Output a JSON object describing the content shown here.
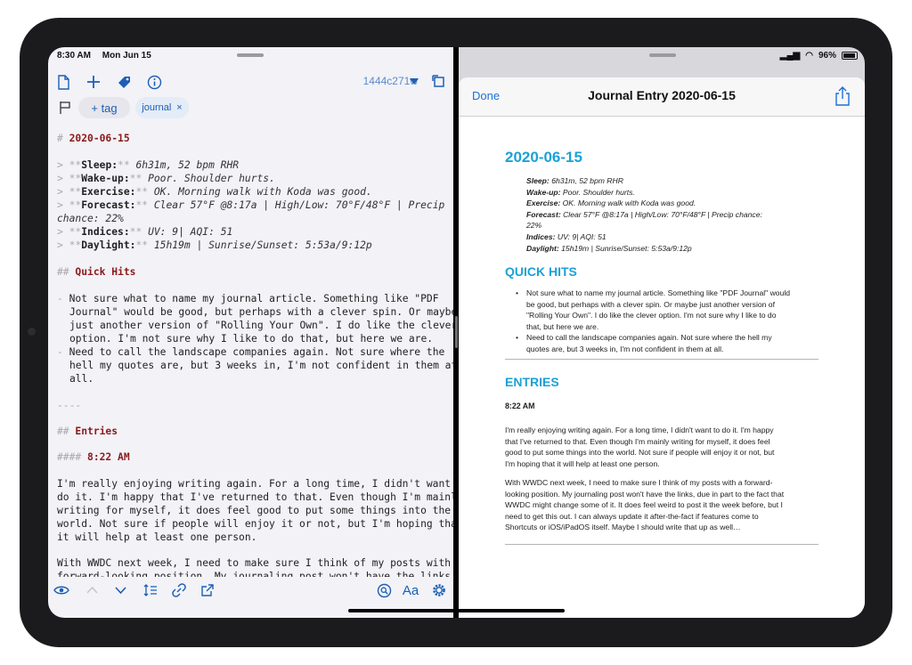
{
  "status": {
    "time": "8:30 AM",
    "date": "Mon Jun 15",
    "battery": "96%",
    "battery_level": 0.96
  },
  "left_toolbar": {
    "doc_id": "1444c271w"
  },
  "tags": {
    "add_label": "+ tag",
    "chip_label": "journal",
    "chip_remove": "×"
  },
  "editor": {
    "h1_marker": "#",
    "h1": "2020-06-15",
    "quote_marker": ">",
    "bold_marker": "**",
    "meta": [
      {
        "label": "Sleep:",
        "value": "6h31m, 52 bpm RHR"
      },
      {
        "label": "Wake-up:",
        "value": "Poor. Shoulder hurts."
      },
      {
        "label": "Exercise:",
        "value": "OK. Morning walk with Koda was good."
      },
      {
        "label": "Forecast:",
        "value": "Clear 57°F @8:17a | High/Low: 70°F/48°F | Precip"
      },
      {
        "label": "Indices:",
        "value": "UV: 9| AQI: 51"
      },
      {
        "label": "Daylight:",
        "value": "15h19m | Sunrise/Sunset: 5:53a/9:12p"
      }
    ],
    "forecast_wrap": "chance: 22%",
    "h2_marker": "##",
    "h2_quick": "Quick Hits",
    "list_marker": "-",
    "quick_lines": [
      "Not sure what to name my journal article. Something like \"PDF",
      "Journal\" would be good, but perhaps with a clever spin. Or maybe",
      "just another version of \"Rolling Your Own\". I do like the clever",
      "option. I'm not sure why I like to do that, but here we are.",
      "Need to call the landscape companies again. Not sure where the",
      "hell my quotes are, but 3 weeks in, I'm not confident in them at",
      "all."
    ],
    "hr": "----",
    "h2_entries": "Entries",
    "h4_marker": "####",
    "h4_time": "8:22 AM",
    "para1_lines": [
      "I'm really enjoying writing again. For a long time, I didn't want to",
      "do it. I'm happy that I've returned to that. Even though I'm mainly",
      "writing for myself, it does feel good to put some things into the",
      "world. Not sure if people will enjoy it or not, but I'm hoping that",
      "it will help at least one person."
    ],
    "para2_lines": [
      "With WWDC next week, I need to make sure I think of my posts with a",
      "forward-looking position. My journaling post won't have the links"
    ]
  },
  "preview": {
    "done_label": "Done",
    "title": "Journal Entry 2020-06-15",
    "h1": "2020-06-15",
    "meta": [
      {
        "label": "Sleep:",
        "value": "6h31m, 52 bpm RHR"
      },
      {
        "label": "Wake-up:",
        "value": "Poor. Shoulder hurts."
      },
      {
        "label": "Exercise:",
        "value": "OK. Morning walk with Koda was good."
      },
      {
        "label": "Forecast:",
        "value": "Clear 57°F @8:17a | High/Low: 70°F/48°F | Precip chance:"
      },
      {
        "label": "Indices:",
        "value": "UV: 9| AQI: 51"
      },
      {
        "label": "Daylight:",
        "value": "15h19m | Sunrise/Sunset: 5:53a/9:12p"
      }
    ],
    "forecast_wrap": "22%",
    "quick_title": "QUICK HITS",
    "bullet1_lines": [
      "Not sure what to name my journal article. Something like \"PDF Journal\" would",
      "be good, but perhaps with a clever spin. Or maybe just another version of",
      "\"Rolling Your Own\". I do like the clever option. I'm not sure why I like to do",
      "that, but here we are."
    ],
    "bullet2_lines": [
      "Need to call the landscape companies again. Not sure where the hell my",
      "quotes are, but 3 weeks in, I'm not confident in them at all."
    ],
    "entries_title": "ENTRIES",
    "time": "8:22 AM",
    "para1_lines": [
      "I'm really enjoying writing again. For a long time, I didn't want to do it. I'm happy",
      "that I've returned to that. Even though I'm mainly writing for myself, it does feel",
      "good to put some things into the world. Not sure if people will enjoy it or not, but",
      "I'm hoping that it will help at least one person."
    ],
    "para2_lines": [
      "With WWDC next week, I need to make sure I think of my posts with a forward-",
      "looking position. My journaling post won't have the links, due in part to the fact that",
      "WWDC might change some of it. It does feel weird to post it the week before, but I",
      "need to get this out. I can always update it after-the-fact if features come to",
      "Shortcuts or iOS/iPadOS itself. Maybe I should write that up as well…"
    ]
  },
  "colors": {
    "accent": "#1c5fb5",
    "heading_md": "#8b1a1a",
    "preview_heading": "#1ba1d6"
  }
}
